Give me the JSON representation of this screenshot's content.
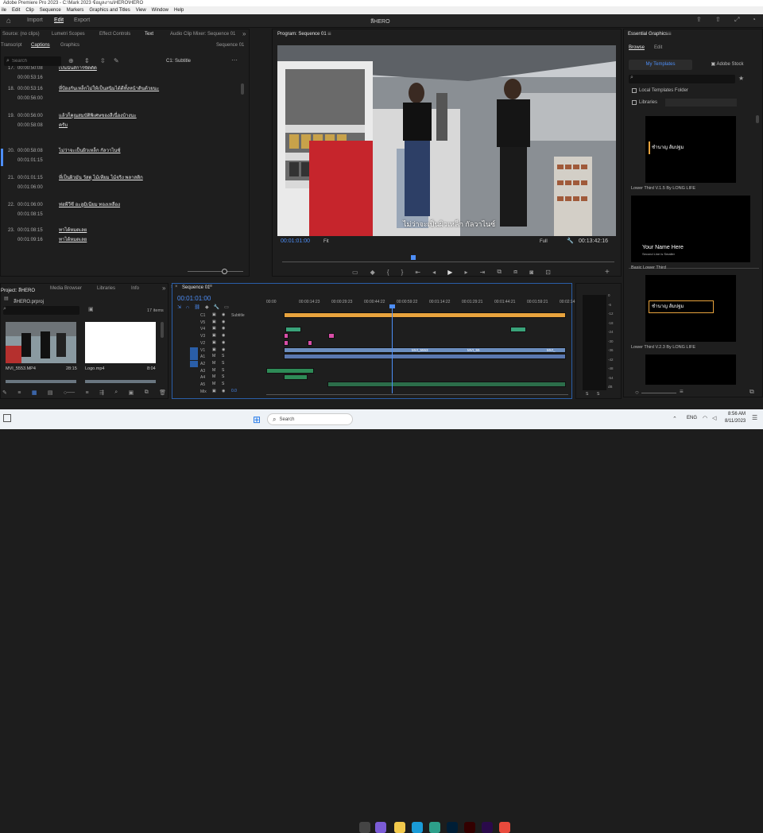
{
  "window": {
    "title": "Adobe Premiere Pro 2023 - C:\\Mark 2023 ข้อมูลงาน\\HERO\\HERO"
  },
  "menu": [
    "ile",
    "Edit",
    "Clip",
    "Sequence",
    "Markers",
    "Graphics and Titles",
    "View",
    "Window",
    "Help"
  ],
  "header": {
    "tabs": [
      "Import",
      "Edit",
      "Export"
    ],
    "active": "Edit",
    "project_title": "ลีHERO"
  },
  "source_panel": {
    "tabs": [
      "Source: (no clips)",
      "Lumetri Scopes",
      "Effect Controls",
      "Text",
      "Audio Clip Mixer: Sequence 01"
    ],
    "sequence_label": "Sequence 01",
    "sub_tabs": [
      "Transcript",
      "Captions",
      "Graphics"
    ],
    "search_placeholder": "Search",
    "track_label": "C1: Subtitle",
    "captions": [
      {
        "num": "17.",
        "t1": "00:00:50:08",
        "t2": "00:00:53:16",
        "txt": "เป็นนั้นสีการขัดตัด"
      },
      {
        "num": "18.",
        "t1": "00:00:53:16",
        "t2": "00:00:56:00",
        "txt": "ที่ป้องกันเหล็กไม่ให้เป็นสนิมได้ดีทั้งหน้าดินด้วยนะ"
      },
      {
        "num": "19.",
        "t1": "00:00:56:00",
        "t2": "00:00:58:08",
        "txt": "แล้วก็คุณสมบัติพิเศษของสีเนื่องบ้างนะ",
        "txt2": "ครับ"
      },
      {
        "num": "20.",
        "t1": "00:00:58:08",
        "t2": "00:01:01:15",
        "txt": "ไม่ว่าจะเป็นผิวเหล็ก กัลวาไนซ์"
      },
      {
        "num": "21.",
        "t1": "00:01:01:15",
        "t2": "00:01:06:00",
        "txt": "ที่เป็นผิวมัน วัสดุ ไม้เทียม ไม้จริง พลาสติก"
      },
      {
        "num": "22.",
        "t1": "00:01:06:00",
        "t2": "00:01:08:15",
        "txt": "ท่อพีวีซี อะลูมิเนียม ทองเหลือง"
      },
      {
        "num": "23.",
        "t1": "00:01:08:15",
        "t2": "00:01:09:16",
        "txt": "ทาได้หมดเลย",
        "txt2": "ทาได้หมดเลย"
      }
    ]
  },
  "program": {
    "title": "Program: Sequence 01",
    "timecode": "00:01:01:00",
    "fit": "Fit",
    "quality": "Full",
    "duration": "00:13:42:16",
    "subtitle_overlay": "ไม่ว่าจะเป็นผิวเหล็ก กัลวาไนซ์"
  },
  "project_panel": {
    "tabs": [
      "Project: ลีHERO",
      "Media Browser",
      "Libraries",
      "Info"
    ],
    "file": "ลีHERO.prproj",
    "items_count": "17 items",
    "thumbs": [
      {
        "name": "MVI_5553.MP4",
        "dur": "28:15"
      },
      {
        "name": "Logo.mp4",
        "dur": "8:04"
      }
    ]
  },
  "timeline": {
    "tab": "Sequence 01",
    "timecode": "00:01:01:00",
    "ruler": [
      "00:00",
      "00:00:14:23",
      "00:00:29:23",
      "00:00:44:22",
      "00:00:59:22",
      "00:01:14:22",
      "00:01:29:21",
      "00:01:44:21",
      "00:01:59:21",
      "00:02:14:20"
    ],
    "tracks": [
      "C1",
      "V5",
      "V4",
      "V3",
      "V2",
      "V1",
      "A1",
      "A2",
      "A3",
      "A4",
      "A5",
      "Mix"
    ],
    "subtitle_track": "Subtitle",
    "mix_value": "0.0",
    "clip_names": [
      "MVI_5553",
      "MVI_55",
      "MVI_"
    ]
  },
  "meter": {
    "scale": [
      "0",
      "-6",
      "-12",
      "-18",
      "-24",
      "-30",
      "-36",
      "-42",
      "-48",
      "-54",
      "dB"
    ],
    "solo": [
      "S",
      "S"
    ]
  },
  "essential_graphics": {
    "title": "Essential Graphics",
    "tabs": [
      "Browse",
      "Edit"
    ],
    "buttons": [
      "My Templates",
      "Adobe Stock"
    ],
    "local_templates": "Local Templates Folder",
    "libraries": "Libraries",
    "templates": [
      {
        "label": "Lower Third V.1.5 By LONG LIFE",
        "thumb_text": "ชำนาญ ส้มปฐม"
      },
      {
        "label": "Basic Lower Third",
        "thumb_text": "Your Name Here",
        "thumb_sub": "Second Line is Smaller"
      },
      {
        "label": "Lower Third V.2.3 By LONG LIFE",
        "thumb_text": "ชำนาญ ส้มปฐม"
      }
    ]
  },
  "taskbar": {
    "search": "Search",
    "lang": "ENG",
    "time": "8:56 AM",
    "date": "8/11/2023"
  },
  "colors": {
    "accent": "#4d8ef7",
    "audio": "#2e8b57",
    "video": "#6c8ebf",
    "subtitle": "#e8a33d",
    "pink": "#d84ea8"
  }
}
